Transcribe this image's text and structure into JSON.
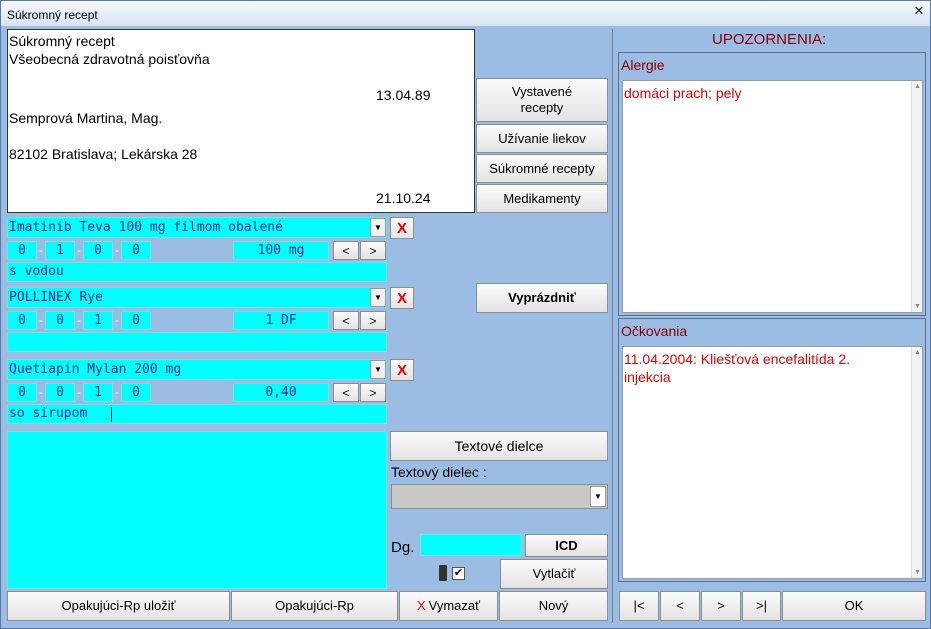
{
  "window": {
    "title": "Súkromný recept",
    "close_glyph": "✕"
  },
  "header": {
    "line1": "Súkromný recept",
    "line2": "Všeobecná zdravotná poisťovňa",
    "birth_date": "13.04.89",
    "patient": "Semprová Martina, Mag.",
    "address": "82102 Bratislava; Lekárska 28",
    "date": "21.10.24"
  },
  "side_buttons": {
    "issued": "Vystavené recepty",
    "drug_usage": "Užívanie liekov",
    "private_rx": "Súkromné recepty",
    "medications": "Medikamenty",
    "clear": "Vyprázdniť"
  },
  "drugs": [
    {
      "name": "Imatinib Teva 100 mg filmom obalené",
      "dose": [
        "0",
        "1",
        "0",
        "0"
      ],
      "amount": "100 mg",
      "note": "s vodou"
    },
    {
      "name": "POLLINEX Rye",
      "dose": [
        "0",
        "0",
        "1",
        "0"
      ],
      "amount": "1 DF",
      "note": ""
    },
    {
      "name": "Quetiapin Mylan 200 mg",
      "dose": [
        "0",
        "0",
        "1",
        "0"
      ],
      "amount": "0,40",
      "note": "so sirupom"
    }
  ],
  "controls": {
    "remove": "X",
    "prev": "<",
    "next": ">",
    "text_parts_button": "Textové dielce",
    "text_part_label": "Textový dielec :",
    "text_part_value": "",
    "dg_label": "Dg.",
    "dg_value": "",
    "icd": "ICD",
    "print": "Vytlačiť"
  },
  "bottom_buttons": {
    "save_repeat": "Opakujúci-Rp uložiť",
    "repeat": "Opakujúci-Rp",
    "delete_x": "X",
    "delete": "Vymazať",
    "new": "Nový"
  },
  "warnings": {
    "heading": "UPOZORNENIA:",
    "allergies_label": "Alergie",
    "allergies_text": "domáci prach; pely",
    "vaccinations_label": "Očkovania",
    "vaccinations_text": "11.04.2004: Kliešťová encefalitída 2. injekcia"
  },
  "nav": {
    "first": "|<",
    "prev": "<",
    "next": ">",
    "last": ">|",
    "ok": "OK"
  },
  "colors": {
    "background": "#9bbce3",
    "cyan": "#00ffff",
    "alert_red": "#e00000",
    "label_red": "#8a0000"
  }
}
